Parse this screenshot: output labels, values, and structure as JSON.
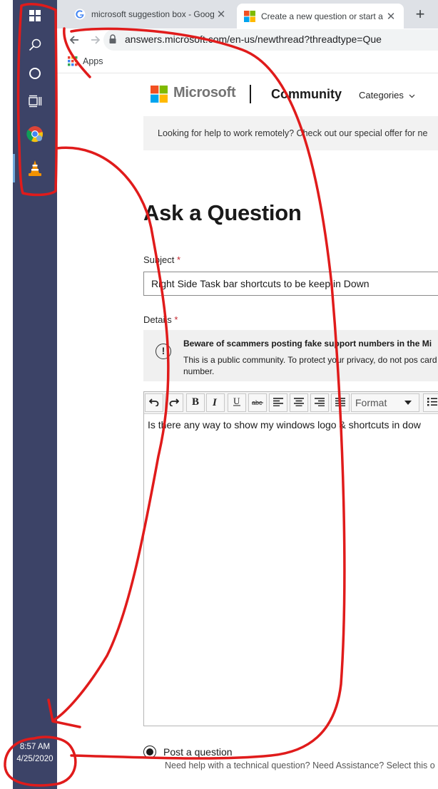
{
  "browser": {
    "tabs": [
      {
        "title": "microsoft suggestion box - Goog",
        "close": "✕"
      },
      {
        "title": "Create a new question or start a d",
        "close": "✕"
      }
    ],
    "new_tab": "+",
    "url": "answers.microsoft.com/en-us/newthread?threadtype=Que",
    "bookmark_apps": "Apps"
  },
  "taskbar": {
    "clock_time": "8:57 AM",
    "clock_date": "4/25/2020"
  },
  "site": {
    "brand": "Microsoft",
    "section": "Community",
    "nav_categories": "Categories",
    "banner": "Looking for help to work remotely? Check out our special offer for ne"
  },
  "form": {
    "title": "Ask a Question",
    "subject_label": "Subject",
    "subject_value": "Right Side Task bar shortcuts to be keep in Down",
    "details_label": "Details",
    "required_mark": "*",
    "warning_title": "Beware of scammers posting fake support numbers in the Mi",
    "warning_body": "This is a public community. To protect your privacy, do not pos card number.",
    "editor_format": "Format",
    "editor_text": "Is there any way to show my windows logo & shortcuts in dow",
    "post_option_label": "Post a question",
    "post_option_desc": "Need help with a technical question? Need Assistance? Select this o"
  },
  "colors": {
    "taskbar_bg": "#3c4367",
    "annotation_red": "#e01b1b",
    "required_red": "#c4262e"
  }
}
